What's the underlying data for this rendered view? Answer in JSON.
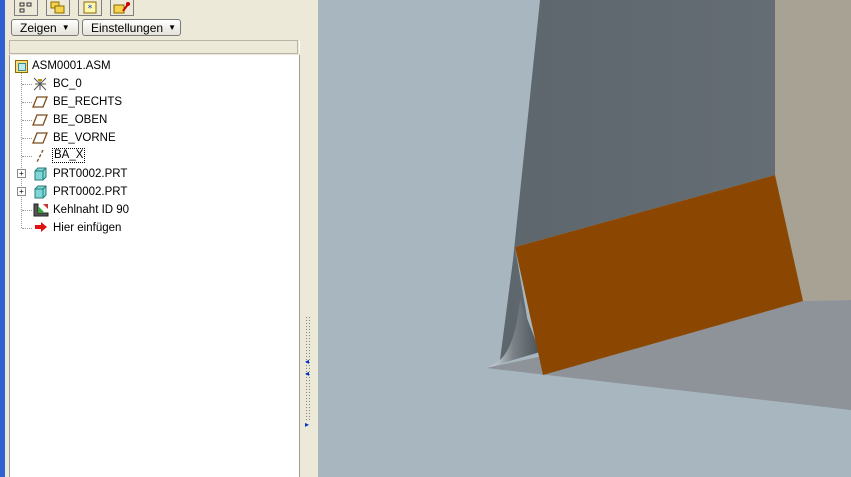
{
  "toolbar": {
    "tabs": [
      {
        "name": "model-tree-tab-icon"
      },
      {
        "name": "layers-tab-icon"
      },
      {
        "name": "favorites-tab-icon"
      },
      {
        "name": "folder-browser-tab-icon"
      }
    ],
    "show_button": "Zeigen",
    "settings_button": "Einstellungen"
  },
  "tree": {
    "root": {
      "label": "ASM0001.ASM",
      "icon": "assembly-icon"
    },
    "items": [
      {
        "label": "BC_0",
        "icon": "coordinate-system-icon",
        "expandable": false
      },
      {
        "label": "BE_RECHTS",
        "icon": "datum-plane-icon",
        "expandable": false
      },
      {
        "label": "BE_OBEN",
        "icon": "datum-plane-icon",
        "expandable": false
      },
      {
        "label": "BE_VORNE",
        "icon": "datum-plane-icon",
        "expandable": false
      },
      {
        "label": "BA_X",
        "icon": "datum-axis-icon",
        "expandable": false
      },
      {
        "label": "PRT0002.PRT",
        "icon": "part-icon",
        "expandable": true
      },
      {
        "label": "PRT0002.PRT",
        "icon": "part-icon",
        "expandable": true
      },
      {
        "label": "Kehlnaht ID 90",
        "icon": "fillet-weld-icon",
        "expandable": false
      },
      {
        "label": "Hier einfügen",
        "icon": "insert-here-arrow-icon",
        "expandable": false
      }
    ]
  },
  "colors": {
    "viewport_bg": "#a8b6c0",
    "plate_dark": "#636b72",
    "plate_light": "#a7a294",
    "weld": "#8b4701",
    "floor": "#8d9398",
    "panel_border": "#2f5fd0"
  }
}
